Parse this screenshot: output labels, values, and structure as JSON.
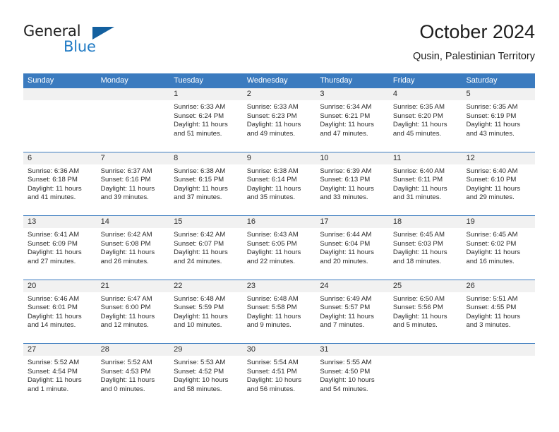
{
  "brand": {
    "word1": "General",
    "word2": "Blue",
    "triangle_color": "#13609f",
    "blue_color": "#1f7ac4"
  },
  "header": {
    "title": "October 2024",
    "subtitle": "Qusin, Palestinian Territory"
  },
  "theme": {
    "header_blue": "#3b7bbf",
    "day_band_gray": "#f1f1f1",
    "text": "#2b2b2b"
  },
  "calendar": {
    "day_headers": [
      "Sunday",
      "Monday",
      "Tuesday",
      "Wednesday",
      "Thursday",
      "Friday",
      "Saturday"
    ],
    "weeks": [
      [
        {
          "day": ""
        },
        {
          "day": ""
        },
        {
          "day": "1",
          "sunrise": "Sunrise: 6:33 AM",
          "sunset": "Sunset: 6:24 PM",
          "daylight1": "Daylight: 11 hours",
          "daylight2": "and 51 minutes."
        },
        {
          "day": "2",
          "sunrise": "Sunrise: 6:33 AM",
          "sunset": "Sunset: 6:23 PM",
          "daylight1": "Daylight: 11 hours",
          "daylight2": "and 49 minutes."
        },
        {
          "day": "3",
          "sunrise": "Sunrise: 6:34 AM",
          "sunset": "Sunset: 6:21 PM",
          "daylight1": "Daylight: 11 hours",
          "daylight2": "and 47 minutes."
        },
        {
          "day": "4",
          "sunrise": "Sunrise: 6:35 AM",
          "sunset": "Sunset: 6:20 PM",
          "daylight1": "Daylight: 11 hours",
          "daylight2": "and 45 minutes."
        },
        {
          "day": "5",
          "sunrise": "Sunrise: 6:35 AM",
          "sunset": "Sunset: 6:19 PM",
          "daylight1": "Daylight: 11 hours",
          "daylight2": "and 43 minutes."
        }
      ],
      [
        {
          "day": "6",
          "sunrise": "Sunrise: 6:36 AM",
          "sunset": "Sunset: 6:18 PM",
          "daylight1": "Daylight: 11 hours",
          "daylight2": "and 41 minutes."
        },
        {
          "day": "7",
          "sunrise": "Sunrise: 6:37 AM",
          "sunset": "Sunset: 6:16 PM",
          "daylight1": "Daylight: 11 hours",
          "daylight2": "and 39 minutes."
        },
        {
          "day": "8",
          "sunrise": "Sunrise: 6:38 AM",
          "sunset": "Sunset: 6:15 PM",
          "daylight1": "Daylight: 11 hours",
          "daylight2": "and 37 minutes."
        },
        {
          "day": "9",
          "sunrise": "Sunrise: 6:38 AM",
          "sunset": "Sunset: 6:14 PM",
          "daylight1": "Daylight: 11 hours",
          "daylight2": "and 35 minutes."
        },
        {
          "day": "10",
          "sunrise": "Sunrise: 6:39 AM",
          "sunset": "Sunset: 6:13 PM",
          "daylight1": "Daylight: 11 hours",
          "daylight2": "and 33 minutes."
        },
        {
          "day": "11",
          "sunrise": "Sunrise: 6:40 AM",
          "sunset": "Sunset: 6:11 PM",
          "daylight1": "Daylight: 11 hours",
          "daylight2": "and 31 minutes."
        },
        {
          "day": "12",
          "sunrise": "Sunrise: 6:40 AM",
          "sunset": "Sunset: 6:10 PM",
          "daylight1": "Daylight: 11 hours",
          "daylight2": "and 29 minutes."
        }
      ],
      [
        {
          "day": "13",
          "sunrise": "Sunrise: 6:41 AM",
          "sunset": "Sunset: 6:09 PM",
          "daylight1": "Daylight: 11 hours",
          "daylight2": "and 27 minutes."
        },
        {
          "day": "14",
          "sunrise": "Sunrise: 6:42 AM",
          "sunset": "Sunset: 6:08 PM",
          "daylight1": "Daylight: 11 hours",
          "daylight2": "and 26 minutes."
        },
        {
          "day": "15",
          "sunrise": "Sunrise: 6:42 AM",
          "sunset": "Sunset: 6:07 PM",
          "daylight1": "Daylight: 11 hours",
          "daylight2": "and 24 minutes."
        },
        {
          "day": "16",
          "sunrise": "Sunrise: 6:43 AM",
          "sunset": "Sunset: 6:05 PM",
          "daylight1": "Daylight: 11 hours",
          "daylight2": "and 22 minutes."
        },
        {
          "day": "17",
          "sunrise": "Sunrise: 6:44 AM",
          "sunset": "Sunset: 6:04 PM",
          "daylight1": "Daylight: 11 hours",
          "daylight2": "and 20 minutes."
        },
        {
          "day": "18",
          "sunrise": "Sunrise: 6:45 AM",
          "sunset": "Sunset: 6:03 PM",
          "daylight1": "Daylight: 11 hours",
          "daylight2": "and 18 minutes."
        },
        {
          "day": "19",
          "sunrise": "Sunrise: 6:45 AM",
          "sunset": "Sunset: 6:02 PM",
          "daylight1": "Daylight: 11 hours",
          "daylight2": "and 16 minutes."
        }
      ],
      [
        {
          "day": "20",
          "sunrise": "Sunrise: 6:46 AM",
          "sunset": "Sunset: 6:01 PM",
          "daylight1": "Daylight: 11 hours",
          "daylight2": "and 14 minutes."
        },
        {
          "day": "21",
          "sunrise": "Sunrise: 6:47 AM",
          "sunset": "Sunset: 6:00 PM",
          "daylight1": "Daylight: 11 hours",
          "daylight2": "and 12 minutes."
        },
        {
          "day": "22",
          "sunrise": "Sunrise: 6:48 AM",
          "sunset": "Sunset: 5:59 PM",
          "daylight1": "Daylight: 11 hours",
          "daylight2": "and 10 minutes."
        },
        {
          "day": "23",
          "sunrise": "Sunrise: 6:48 AM",
          "sunset": "Sunset: 5:58 PM",
          "daylight1": "Daylight: 11 hours",
          "daylight2": "and 9 minutes."
        },
        {
          "day": "24",
          "sunrise": "Sunrise: 6:49 AM",
          "sunset": "Sunset: 5:57 PM",
          "daylight1": "Daylight: 11 hours",
          "daylight2": "and 7 minutes."
        },
        {
          "day": "25",
          "sunrise": "Sunrise: 6:50 AM",
          "sunset": "Sunset: 5:56 PM",
          "daylight1": "Daylight: 11 hours",
          "daylight2": "and 5 minutes."
        },
        {
          "day": "26",
          "sunrise": "Sunrise: 5:51 AM",
          "sunset": "Sunset: 4:55 PM",
          "daylight1": "Daylight: 11 hours",
          "daylight2": "and 3 minutes."
        }
      ],
      [
        {
          "day": "27",
          "sunrise": "Sunrise: 5:52 AM",
          "sunset": "Sunset: 4:54 PM",
          "daylight1": "Daylight: 11 hours",
          "daylight2": "and 1 minute."
        },
        {
          "day": "28",
          "sunrise": "Sunrise: 5:52 AM",
          "sunset": "Sunset: 4:53 PM",
          "daylight1": "Daylight: 11 hours",
          "daylight2": "and 0 minutes."
        },
        {
          "day": "29",
          "sunrise": "Sunrise: 5:53 AM",
          "sunset": "Sunset: 4:52 PM",
          "daylight1": "Daylight: 10 hours",
          "daylight2": "and 58 minutes."
        },
        {
          "day": "30",
          "sunrise": "Sunrise: 5:54 AM",
          "sunset": "Sunset: 4:51 PM",
          "daylight1": "Daylight: 10 hours",
          "daylight2": "and 56 minutes."
        },
        {
          "day": "31",
          "sunrise": "Sunrise: 5:55 AM",
          "sunset": "Sunset: 4:50 PM",
          "daylight1": "Daylight: 10 hours",
          "daylight2": "and 54 minutes."
        },
        {
          "day": ""
        },
        {
          "day": ""
        }
      ]
    ]
  }
}
